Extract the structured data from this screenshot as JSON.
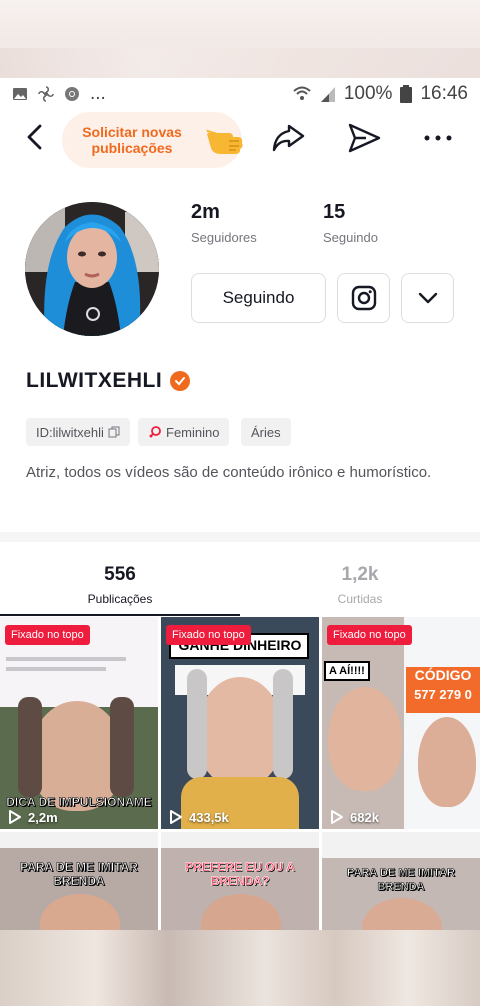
{
  "status_bar": {
    "dots": "...",
    "battery_percent": "100%",
    "time": "16:46",
    "icons": [
      "image-icon",
      "fan-icon",
      "chrome-icon",
      "wifi-icon",
      "signal-icon",
      "battery-icon"
    ]
  },
  "topnav": {
    "request_label_1": "Solicitar novas",
    "request_label_2": "publicações",
    "icons": [
      "back-icon",
      "hand-pointing-icon",
      "share-icon",
      "send-icon",
      "more-icon"
    ]
  },
  "profile": {
    "followers_count": "2m",
    "followers_label": "Seguidores",
    "following_count": "15",
    "following_label": "Seguindo",
    "following_button": "Seguindo",
    "username": "LILWITXEHLI",
    "id_chip": "ID:lilwitxehli",
    "gender_chip": "Feminino",
    "sign_chip": "Áries",
    "bio": "Atriz, todos os vídeos são de conteúdo irônico e humorístico."
  },
  "tabs": {
    "posts_count": "556",
    "posts_label": "Publicações",
    "likes_count": "1,2k",
    "likes_label": "Curtidas"
  },
  "videos": [
    {
      "pinned": "Fixado no topo",
      "views": "2,2m",
      "overlay": "DICA DE IMPULSIONAME"
    },
    {
      "pinned": "Fixado no topo",
      "views": "433,5k",
      "overlay": "GANHE DINHEIRO"
    },
    {
      "pinned": "Fixado no topo",
      "views": "682k",
      "overlay": "CÓDIGO",
      "overlay2": "577 279 0",
      "overlay3": "A AÍ!!!!"
    },
    {
      "overlay": "PARA DE ME IMITAR BRENDA"
    },
    {
      "overlay": "PREFERE EU OU A BRENDA?"
    },
    {
      "overlay": "PARA DE ME IMITAR BRENDA"
    }
  ],
  "colors": {
    "accent_orange": "#f06a1e",
    "pin_red": "#ee1d3d",
    "text_primary": "#161823",
    "text_secondary": "#75767c"
  }
}
